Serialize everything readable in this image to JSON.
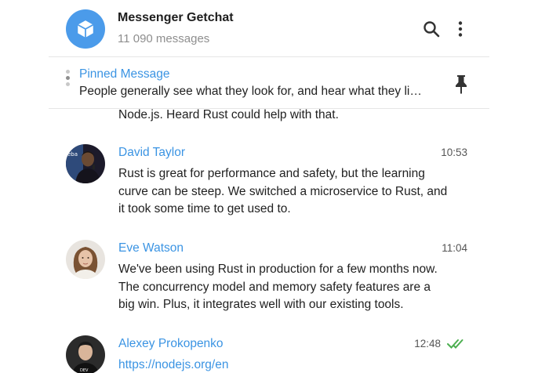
{
  "header": {
    "title": "Messenger Getchat",
    "subtitle": "11 090 messages",
    "avatar_icon": "cube-icon",
    "search_icon": "search-icon",
    "menu_icon": "more-vertical-icon"
  },
  "pinned": {
    "title": "Pinned Message",
    "text": "People generally see what they look for, and hear what they li…",
    "icon": "pin-icon"
  },
  "partial_message": "Node.js. Heard Rust could help with that.",
  "messages": [
    {
      "author": "David Taylor",
      "time": "10:53",
      "lines": [
        "Rust is great for performance and safety, but the learning",
        "curve can be steep. We switched a microservice to Rust, and",
        "it took some time to get used to."
      ]
    },
    {
      "author": "Eve Watson",
      "time": "11:04",
      "lines": [
        "We've been using Rust in production for a few months now.",
        "The concurrency model and memory safety features are a",
        "big win. Plus, it integrates well with our existing tools."
      ]
    },
    {
      "author": "Alexey Prokopenko",
      "time": "12:48",
      "status": "read-double-check-icon",
      "link": "https://nodejs.org/en"
    }
  ],
  "colors": {
    "accent": "#3b94e3",
    "avatar_bg": "#4b9bea",
    "read_check": "#4caf50"
  }
}
